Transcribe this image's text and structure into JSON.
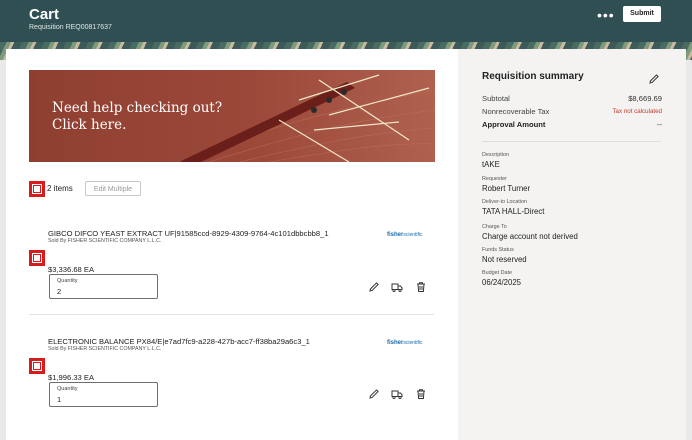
{
  "header": {
    "title": "Cart",
    "requisition": "Requisition REQ00817637",
    "more": "•••",
    "submit_label": "Submit"
  },
  "banner": {
    "line1": "Need help checking out?",
    "line2": "Click here."
  },
  "cart": {
    "items_count": "2 items",
    "edit_multiple_label": "Edit Multiple",
    "items": [
      {
        "name": "GIBCO DIFCO YEAST EXTRACT UF|91585ccd-8929-4309-9764-4c101dbbcbb8_1",
        "sold_by": "Sold By FISHER SCIENTIFIC COMPANY L.L.C.",
        "supplier_logo": "fisher",
        "supplier_logo_sub": "scientific",
        "price": "$3,336.68 EA",
        "quantity_label": "Quantity",
        "quantity": "2"
      },
      {
        "name": "ELECTRONIC BALANCE PX84/E|e7ad7fc9-a228-427b-acc7-ff38ba29a6c3_1",
        "sold_by": "Sold By FISHER SCIENTIFIC COMPANY L.L.C.",
        "supplier_logo": "fisher",
        "supplier_logo_sub": "scientific",
        "price": "$1,996.33 EA",
        "quantity_label": "Quantity",
        "quantity": "1"
      }
    ]
  },
  "summary": {
    "title": "Requisition summary",
    "subtotal_label": "Subtotal",
    "subtotal_value": "$8,669.69",
    "tax_label": "Nonrecoverable Tax",
    "tax_value": "Tax not calculated",
    "approval_label": "Approval Amount",
    "approval_value": "--",
    "details": [
      {
        "label": "Description",
        "value": "tAKE"
      },
      {
        "label": "Requester",
        "value": "Robert Turner"
      },
      {
        "label": "Deliver-to Location",
        "value": "TATA HALL-Direct"
      },
      {
        "label": "Charge To",
        "value": "Charge account not derived"
      },
      {
        "label": "Funds Status",
        "value": "Not reserved"
      },
      {
        "label": "Budget Date",
        "value": "06/24/2025"
      }
    ]
  },
  "colors": {
    "header": "#2f4f52",
    "banner": "#9b4839",
    "checkbox_highlight": "#d81b1b",
    "tax_warning": "#c0392b"
  },
  "icons": {
    "edit": "pencil-icon",
    "delivery": "truck-icon",
    "delete": "trash-icon",
    "summary_edit": "pencil-icon"
  }
}
